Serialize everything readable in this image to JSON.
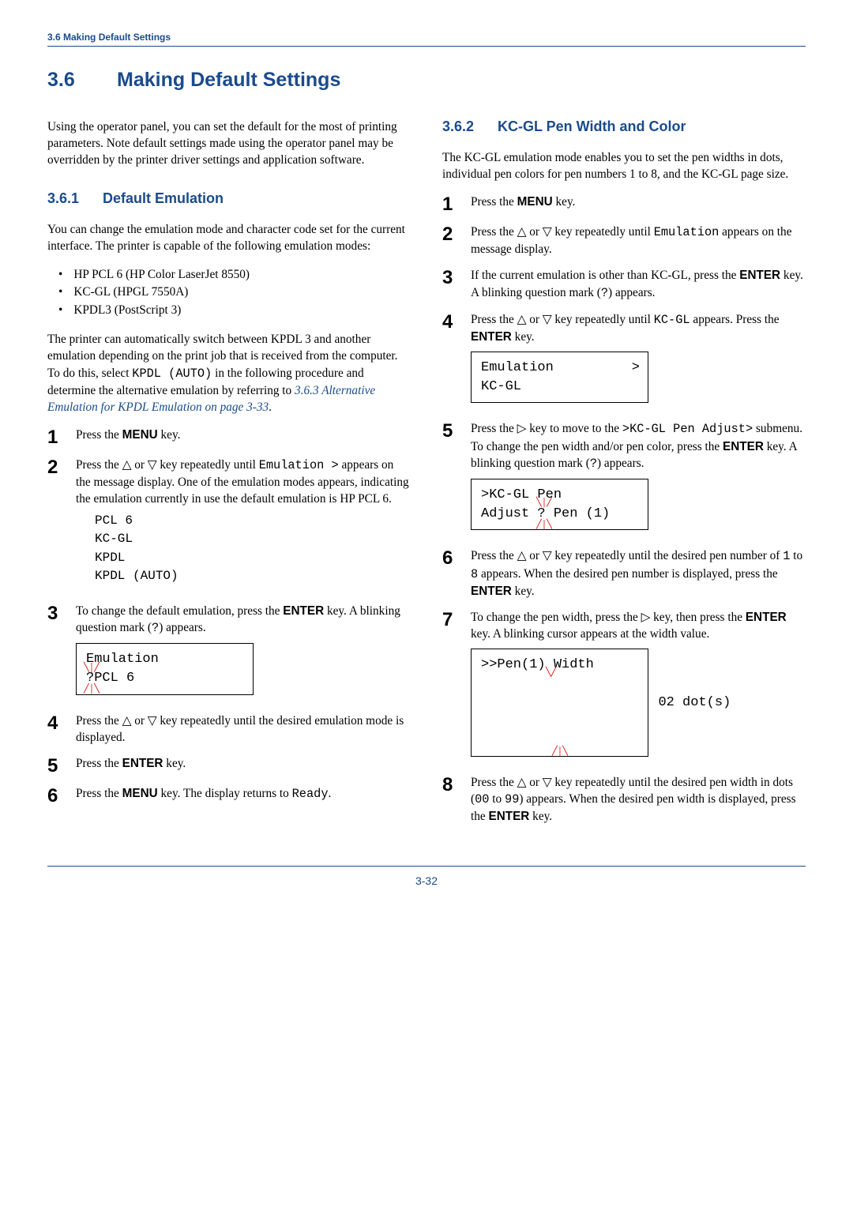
{
  "breadcrumb": "3.6 Making Default Settings",
  "title": {
    "num": "3.6",
    "text": "Making Default Settings"
  },
  "intro": "Using the operator panel, you can set the default for the most of printing parameters. Note default settings made using the operator panel may be overridden by the printer driver settings and application software.",
  "sub1": {
    "num": "3.6.1",
    "text": "Default Emulation",
    "p1": "You can change the emulation mode and character code set for the current interface. The printer is capable of the following emulation modes:",
    "bullets": [
      "HP PCL 6 (HP Color LaserJet 8550)",
      "KC-GL (HPGL 7550A)",
      "KPDL3 (PostScript 3)"
    ],
    "p2a": "The printer can automatically switch between KPDL 3 and another emulation depending on the print job that is received from the computer. To do this, select ",
    "p2_code": "KPDL (AUTO)",
    "p2b": " in the following procedure and determine the alternative emulation by referring to ",
    "p2_link": "3.6.3 Alternative Emulation for KPDL Emulation on page 3-33",
    "steps": {
      "s1a": "Press the ",
      "s1_key": "MENU",
      "s1b": " key.",
      "s2a": "Press the △ or ▽ key repeatedly until ",
      "s2_code": "Emulation >",
      "s2b": " appears on the message display. One of the emulation modes appears, indicating the emulation currently in use the default emulation is HP PCL 6.",
      "s2_code_block": "PCL 6\nKC-GL\nKPDL\nKPDL (AUTO)",
      "s3a": "To change the default emulation, press the ",
      "s3_key": "ENTER",
      "s3b": " key. A blinking question mark (",
      "s3_code": "?",
      "s3c": ") appears.",
      "s3_display_l1": "Emulation",
      "s3_display_l2": "?PCL 6",
      "s4": "Press the △ or ▽ key repeatedly until the desired emulation mode is displayed.",
      "s5a": "Press the ",
      "s5_key": "ENTER",
      "s5b": " key.",
      "s6a": "Press the ",
      "s6_key": "MENU",
      "s6b": " key. The display returns to ",
      "s6_code": "Ready",
      "s6c": "."
    }
  },
  "sub2": {
    "num": "3.6.2",
    "text": "KC-GL Pen Width and Color",
    "p1": "The KC-GL emulation mode enables you to set the pen widths in dots, individual pen colors for pen numbers 1 to 8, and the KC-GL page size.",
    "steps": {
      "s1a": "Press the ",
      "s1_key": "MENU",
      "s1b": " key.",
      "s2a": "Press the △ or ▽ key repeatedly until ",
      "s2_code": "Emulation",
      "s2b": " appears on the message display.",
      "s3a": "If the current emulation is other than KC-GL, press the ",
      "s3_key": "ENTER",
      "s3b": " key. A blinking question mark (",
      "s3_code": "?",
      "s3c": ") appears.",
      "s4a": "Press the △ or ▽ key repeatedly until ",
      "s4_code": "KC-GL",
      "s4b": " appears. Press the ",
      "s4_key": "ENTER",
      "s4c": " key.",
      "s4_display_l1": "Emulation",
      "s4_display_l2": " KC-GL",
      "s5a": "Press the ▷ key to move to the ",
      "s5_code1": ">KC-GL Pen Adjust>",
      "s5b": " submenu. To change the pen width and/or pen color, press the ",
      "s5_key": "ENTER",
      "s5c": " key. A blinking question mark (",
      "s5_code2": "?",
      "s5d": ") appears.",
      "s5_display_l1": ">KC-GL Pen",
      "s5_display_l2a": "Adjust ",
      "s5_display_l2b": "?",
      "s5_display_l2c": " Pen (1)",
      "s6a": "Press the △ or ▽ key repeatedly until the desired pen number of ",
      "s6_code1": "1",
      "s6b": " to ",
      "s6_code2": "8",
      "s6c": " appears. When the desired pen number is displayed, press the ",
      "s6_key": "ENTER",
      "s6d": " key.",
      "s7a": "To change the pen width, press the ▷ key, then press the ",
      "s7_key": "ENTER",
      "s7b": " key. A blinking cursor appears at the width value.",
      "s7_display_l1": ">>Pen(1) Width",
      "s7_display_l2a": "        ",
      "s7_display_l2b": "02",
      "s7_display_l2c": " dot(s)",
      "s8a": "Press the △ or ▽ key repeatedly until the desired pen width in dots (",
      "s8_code1": "00",
      "s8b": " to ",
      "s8_code2": "99",
      "s8c": ") appears. When the desired pen width is displayed, press the ",
      "s8_key": "ENTER",
      "s8d": " key."
    }
  },
  "page_number": "3-32",
  "numbers": {
    "n1": "1",
    "n2": "2",
    "n3": "3",
    "n4": "4",
    "n5": "5",
    "n6": "6",
    "n7": "7",
    "n8": "8"
  }
}
